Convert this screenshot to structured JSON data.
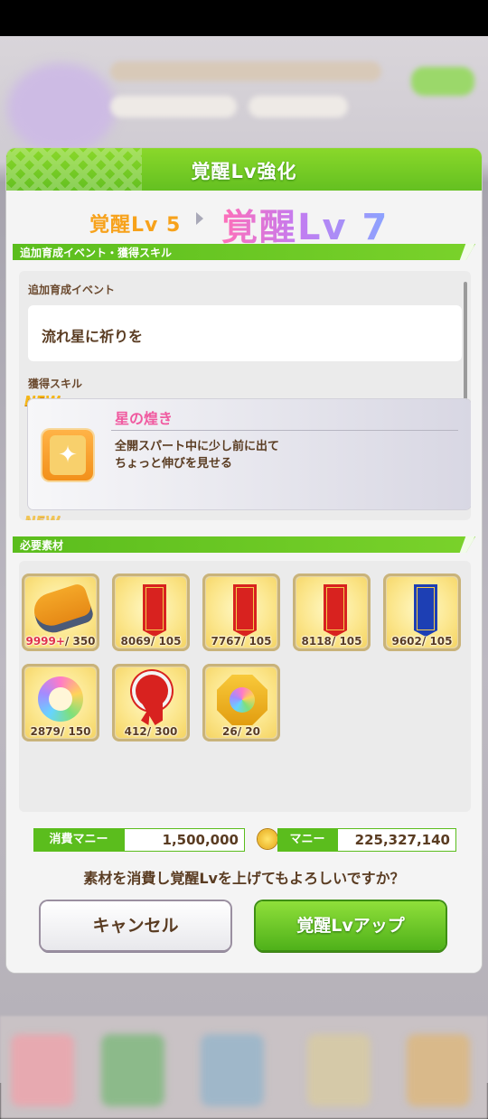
{
  "dialog": {
    "title": "覚醒Lv強化",
    "from_level": "覚醒Lv 5",
    "to_level": "覚醒Lv 7",
    "section_skill": "追加育成イベント・獲得スキル",
    "event_label": "追加育成イベント",
    "event_name": "流れ星に祈りを",
    "skill_label": "獲得スキル",
    "new_tag": "NEW",
    "skill_name": "星の煌き",
    "skill_desc_1": "全開スパート中に少し前に出て",
    "skill_desc_2": "ちょっと伸びを見せる",
    "section_materials": "必要素材",
    "materials": [
      {
        "name": "shoes-icon",
        "have": "9999+",
        "need": "/ 350",
        "over": true
      },
      {
        "name": "pennant-icon",
        "have": "8069",
        "need": "/ 105"
      },
      {
        "name": "pennant-icon",
        "have": "7767",
        "need": "/ 105"
      },
      {
        "name": "pennant-icon",
        "have": "8118",
        "need": "/ 105"
      },
      {
        "name": "pennant-icon",
        "have": "9602",
        "need": "/ 105"
      },
      {
        "name": "horseshoe-ring-icon",
        "have": "2879",
        "need": "/ 150"
      },
      {
        "name": "rosette-icon",
        "have": "412",
        "need": "/ 300"
      },
      {
        "name": "medal-icon",
        "have": "26",
        "need": "/ 20"
      }
    ],
    "cost_label": "消費マニー",
    "cost_value": "1,500,000",
    "money_label": "マニー",
    "money_value": "225,327,140",
    "confirm_text": "素材を消費し覚醒Lvを上げてもよろしいですか？",
    "cancel_label": "キャンセル",
    "ok_label": "覚醒Lvアップ"
  },
  "colors": {
    "header_green": "#64c021",
    "accent_orange": "#f7a21b",
    "skill_pink": "#f05aa0",
    "text_brown": "#5a3c22"
  }
}
